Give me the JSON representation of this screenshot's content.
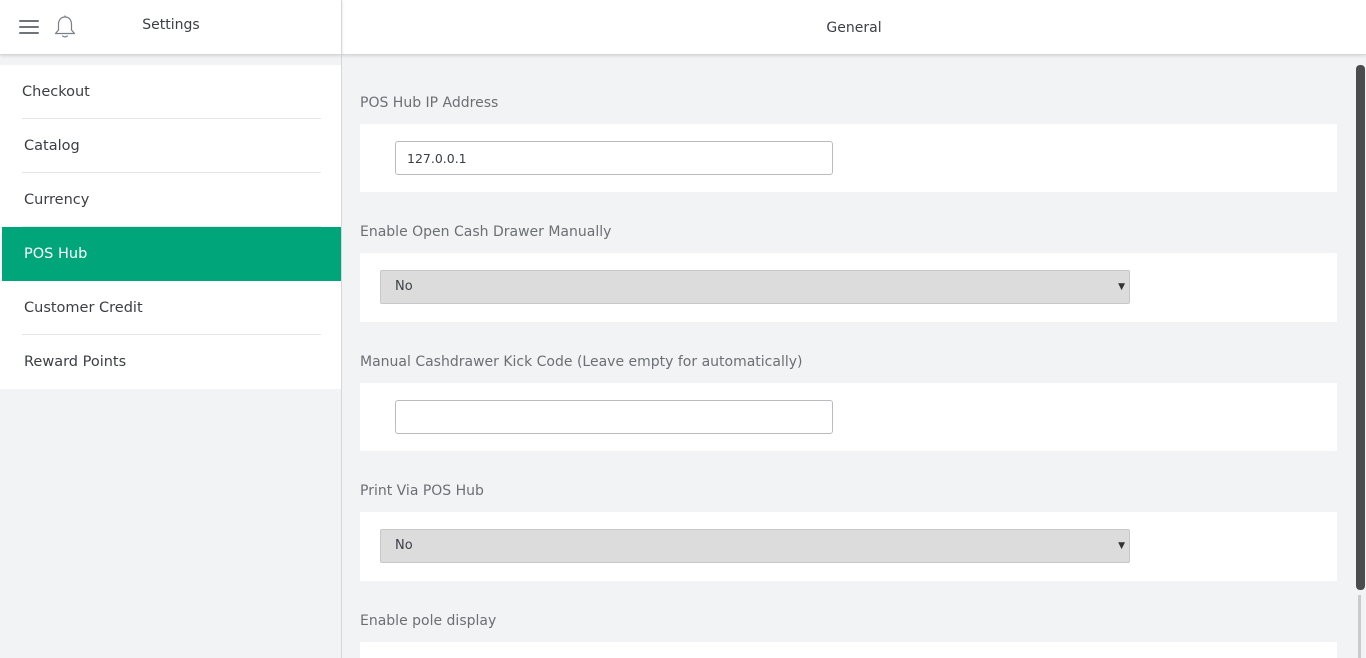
{
  "header": {
    "left_title": "Settings",
    "right_title": "General",
    "icons": [
      "menu-icon",
      "bell-icon"
    ]
  },
  "sidebar": {
    "items": [
      {
        "label": "Checkout",
        "active": false
      },
      {
        "label": "Catalog",
        "active": false
      },
      {
        "label": "Currency",
        "active": false
      },
      {
        "label": "POS Hub",
        "active": true
      },
      {
        "label": "Customer Credit",
        "active": false
      },
      {
        "label": "Reward Points",
        "active": false
      }
    ]
  },
  "main": {
    "sections": [
      {
        "label": "POS Hub IP Address",
        "type": "text",
        "value": "127.0.0.1"
      },
      {
        "label": "Enable Open Cash Drawer Manually",
        "type": "select",
        "value": "No"
      },
      {
        "label": "Manual Cashdrawer Kick Code (Leave empty for automatically)",
        "type": "text",
        "value": ""
      },
      {
        "label": "Print Via POS Hub",
        "type": "select",
        "value": "No"
      },
      {
        "label": "Enable pole display",
        "type": "select",
        "value": ""
      }
    ]
  },
  "colors": {
    "accent": "#00a67a",
    "background": "#f2f3f4",
    "select_bg": "#dcdcdc"
  }
}
